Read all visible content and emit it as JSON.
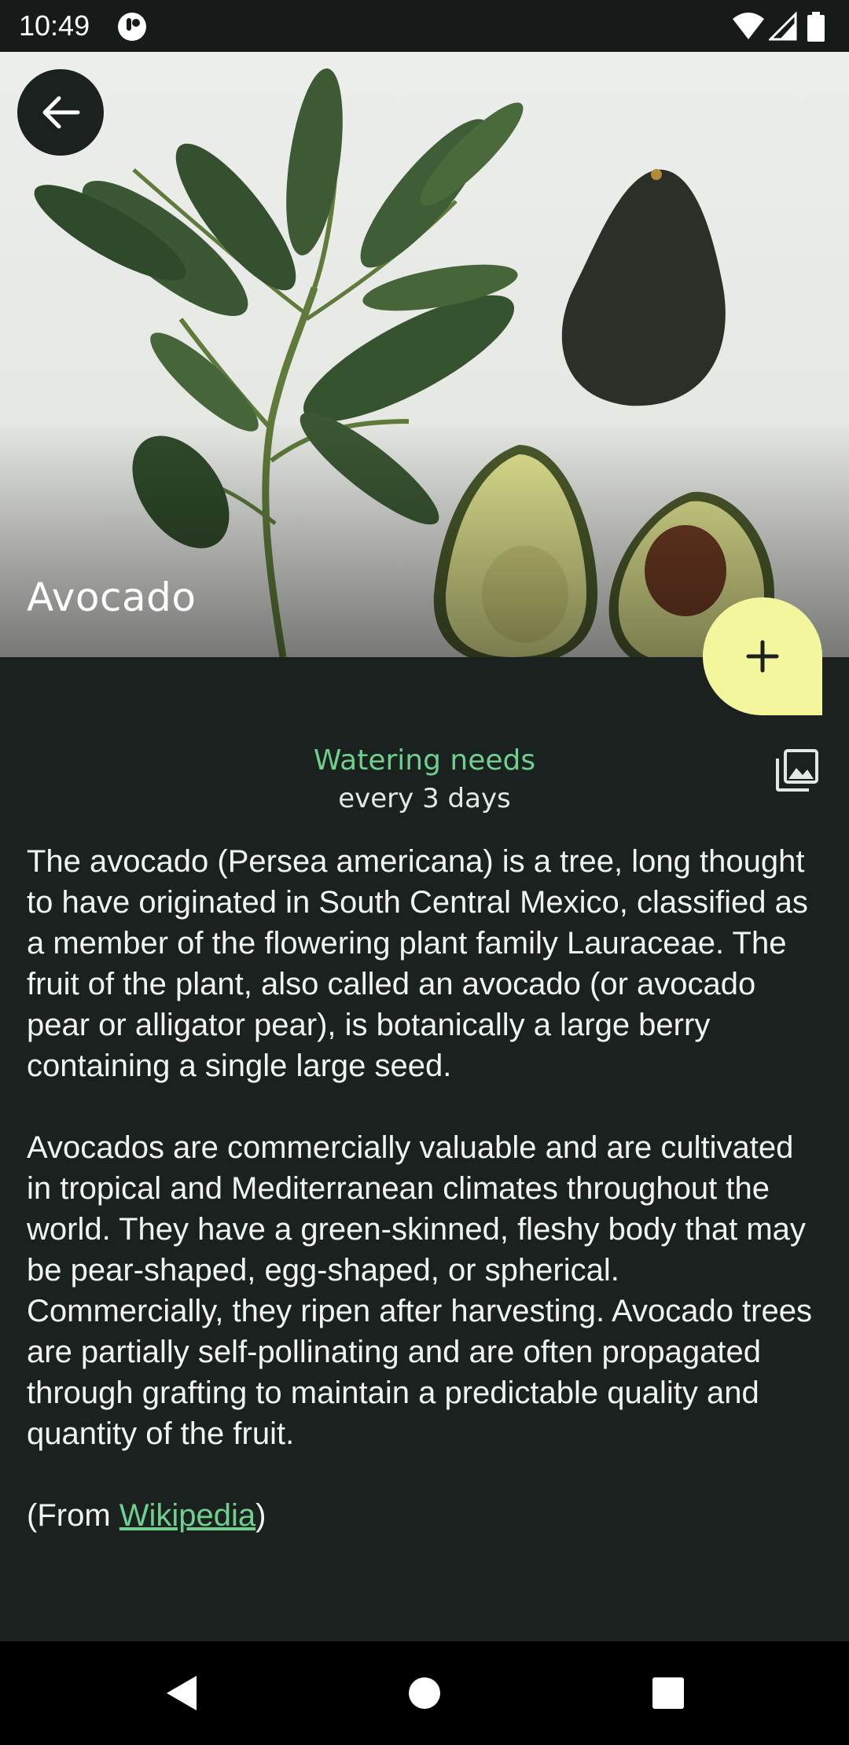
{
  "status_bar": {
    "time": "10:49",
    "icons": [
      "app-notification-icon",
      "wifi-icon",
      "cell-signal-icon",
      "battery-icon"
    ]
  },
  "header": {
    "back_icon": "arrow-left-icon",
    "title": "Avocado"
  },
  "fab": {
    "icon": "plus-icon"
  },
  "watering": {
    "label": "Watering needs",
    "value": "every 3 days",
    "gallery_icon": "photo-library-icon"
  },
  "description": {
    "paragraph_1": "The avocado (Persea americana) is a tree, long thought to have originated in South Central Mexico, classified as a member of the flowering plant family Lauraceae. The fruit of the plant, also called an avocado (or avocado pear or alligator pear), is botanically a large berry containing a single large seed.",
    "paragraph_2": "Avocados are commercially valuable and are cultivated in tropical and Mediterranean climates throughout the world. They have a green-skinned, fleshy body that may be pear-shaped, egg-shaped, or spherical. Commercially, they ripen after harvesting. Avocado trees are partially self-pollinating and are often propagated through grafting to maintain a predictable quality and quantity of the fruit.",
    "source_prefix": "(From ",
    "source_link": "Wikipedia",
    "source_suffix": ")"
  },
  "colors": {
    "background": "#1b211f",
    "accent_green": "#6fcf8f",
    "fab_yellow": "#f4f69e"
  },
  "nav_bar": {
    "icons": [
      "back-triangle-icon",
      "home-circle-icon",
      "recents-square-icon"
    ]
  }
}
